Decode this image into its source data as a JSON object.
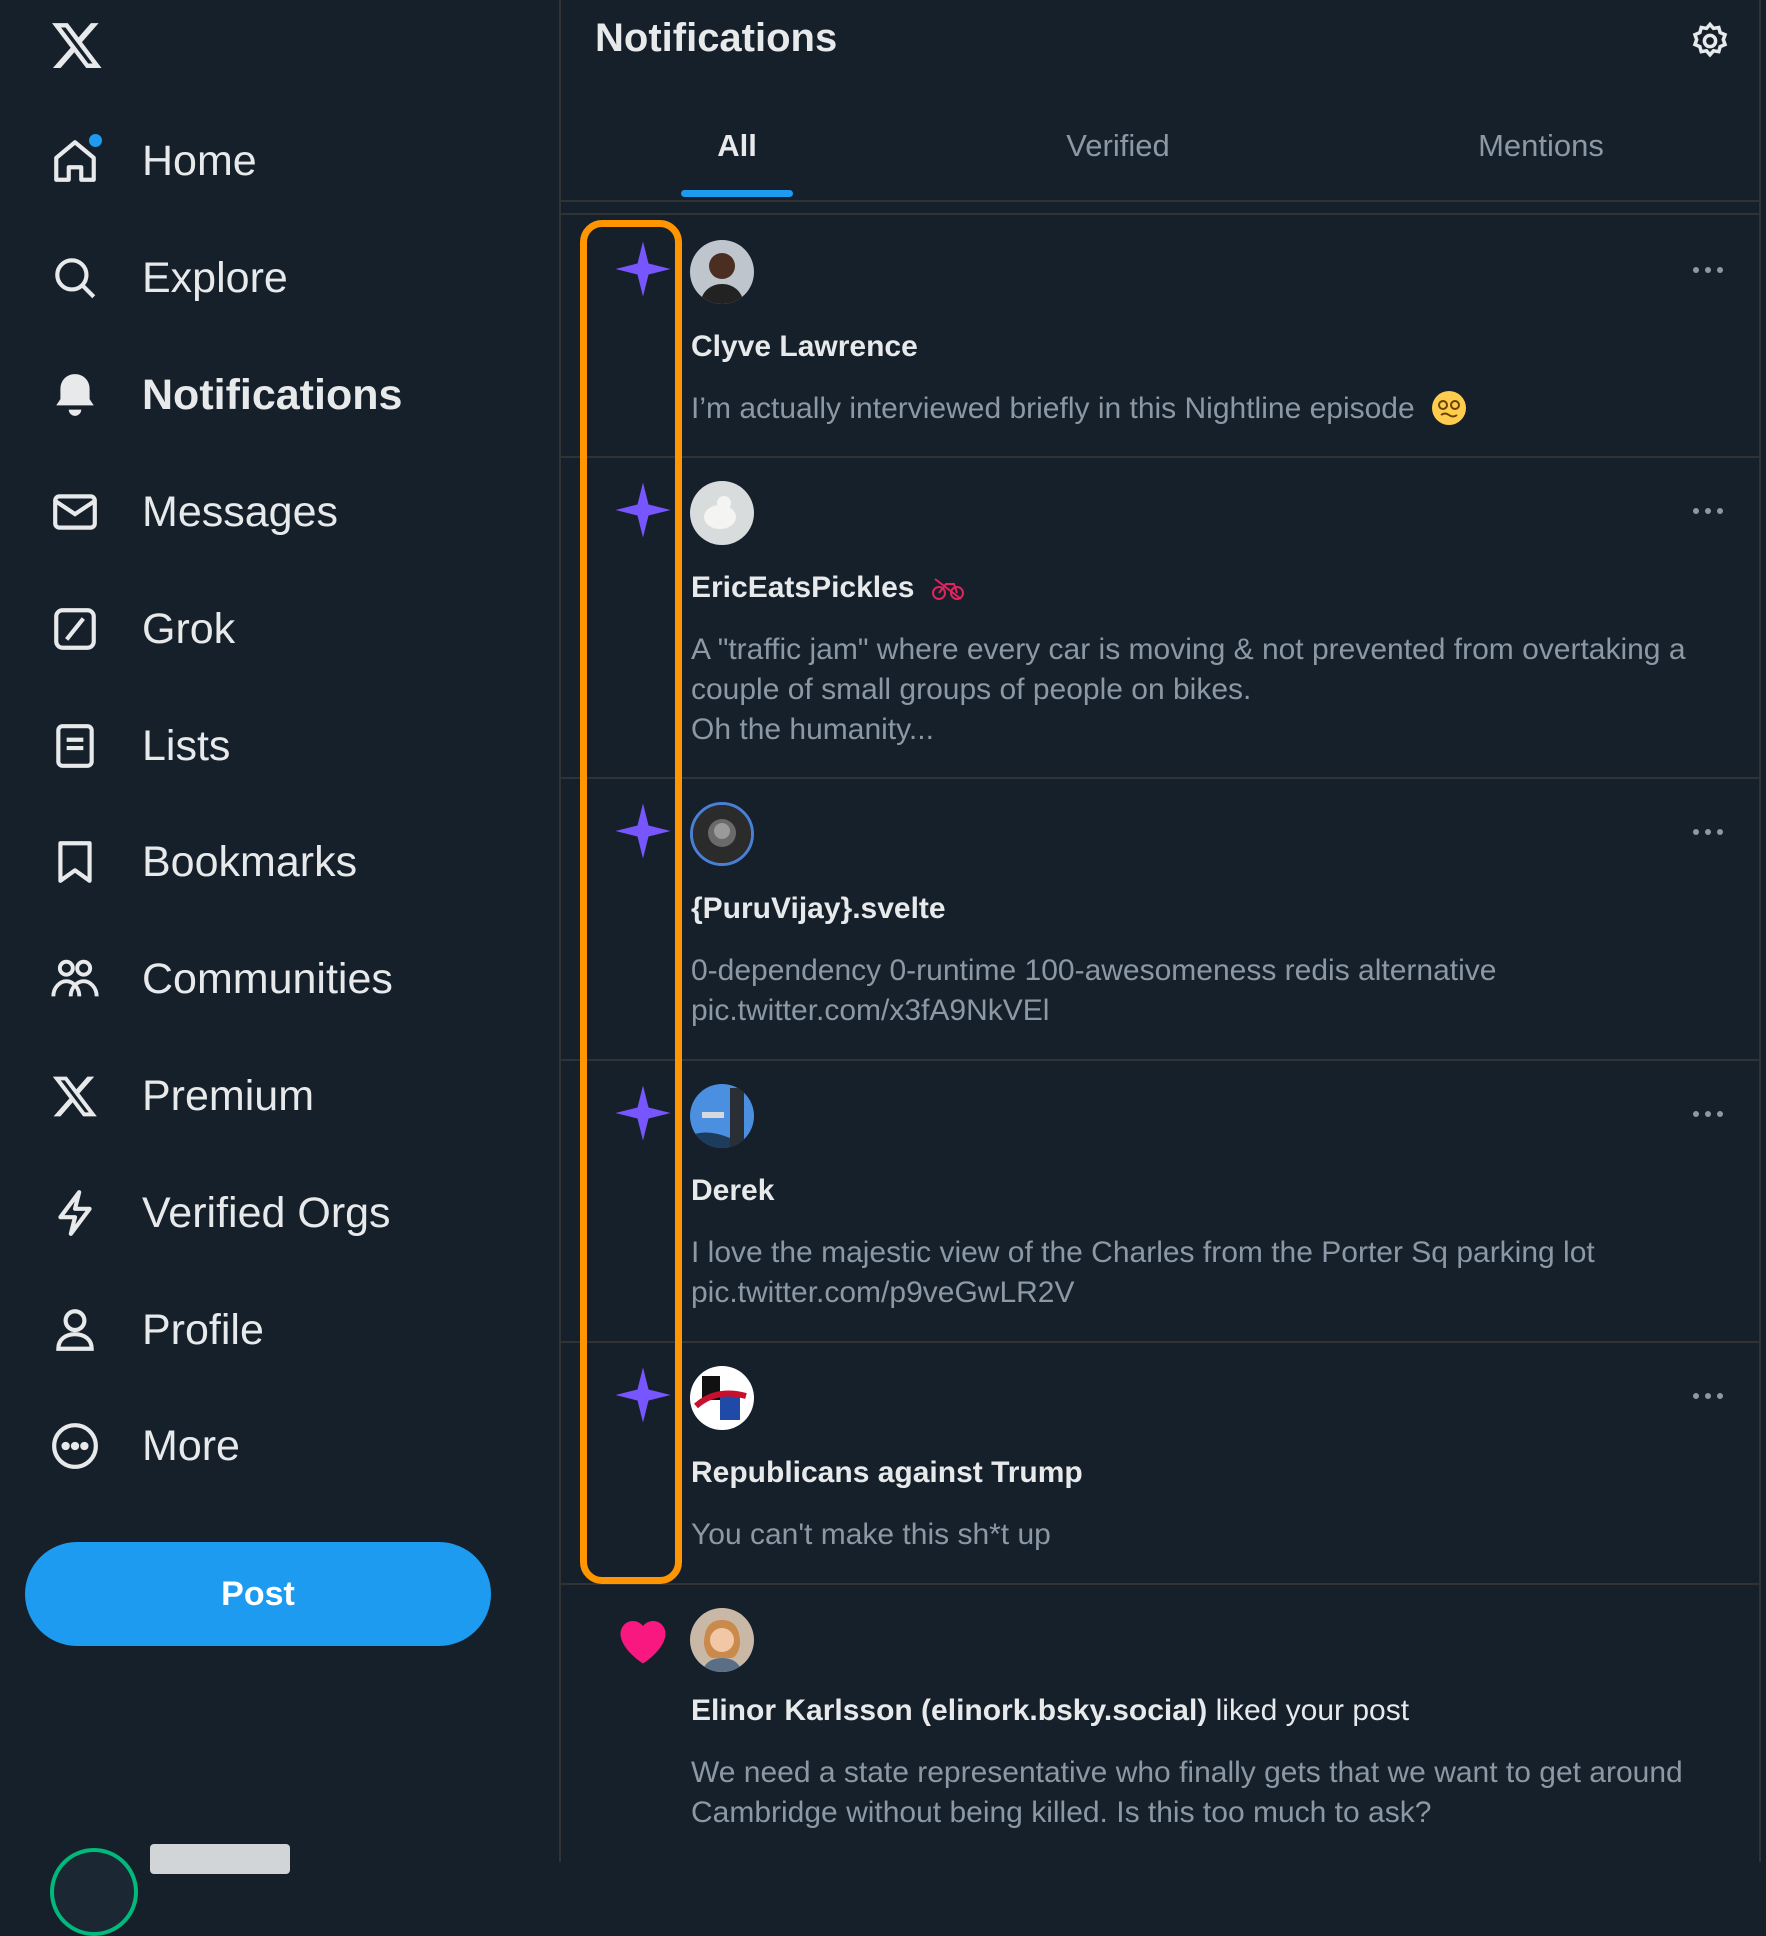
{
  "sidebar": {
    "items": [
      {
        "label": "Home",
        "icon": "home-icon"
      },
      {
        "label": "Explore",
        "icon": "search-icon"
      },
      {
        "label": "Notifications",
        "icon": "bell-icon"
      },
      {
        "label": "Messages",
        "icon": "envelope-icon"
      },
      {
        "label": "Grok",
        "icon": "grok-icon"
      },
      {
        "label": "Lists",
        "icon": "list-icon"
      },
      {
        "label": "Bookmarks",
        "icon": "bookmark-icon"
      },
      {
        "label": "Communities",
        "icon": "communities-icon"
      },
      {
        "label": "Premium",
        "icon": "x-logo-icon"
      },
      {
        "label": "Verified Orgs",
        "icon": "lightning-icon"
      },
      {
        "label": "Profile",
        "icon": "person-icon"
      },
      {
        "label": "More",
        "icon": "more-circle-icon"
      }
    ],
    "post_label": "Post"
  },
  "header": {
    "title": "Notifications"
  },
  "tabs": [
    {
      "label": "All",
      "active": true
    },
    {
      "label": "Verified",
      "active": false
    },
    {
      "label": "Mentions",
      "active": false
    }
  ],
  "notifications": [
    {
      "type": "sparkle",
      "author": "Clyve Lawrence",
      "text": "I’m actually interviewed briefly in this Nightline episode",
      "emoji": "dizzy-face-emoji"
    },
    {
      "type": "sparkle",
      "author": "EricEatsPickles",
      "badge": "no-bikes-emoji",
      "text": "A \"traffic jam\" where every car is moving & not prevented from overtaking a couple of small groups of people on bikes.\nOh the humanity..."
    },
    {
      "type": "sparkle",
      "author": "{PuruVijay}.svelte",
      "text": "0-dependency 0-runtime 100-awesomeness redis alternative pic.twitter.com/x3fA9NkVEl"
    },
    {
      "type": "sparkle",
      "author": "Derek",
      "text": "I love the majestic view of the Charles from the Porter Sq parking lot pic.twitter.com/p9veGwLR2V"
    },
    {
      "type": "sparkle",
      "author": "Republicans against Trump",
      "text": "You can't make this sh*t up"
    },
    {
      "type": "like",
      "author": "Elinor Karlsson (elinork.bsky.social)",
      "action": "liked your post",
      "text": "We need a state representative who finally gets that we want to get around Cambridge without being killed. Is this too much to ask?"
    }
  ],
  "colors": {
    "accent": "#1d9bf0",
    "sparkle": "#7856ff",
    "like": "#f91880",
    "highlight": "#ff9500"
  }
}
